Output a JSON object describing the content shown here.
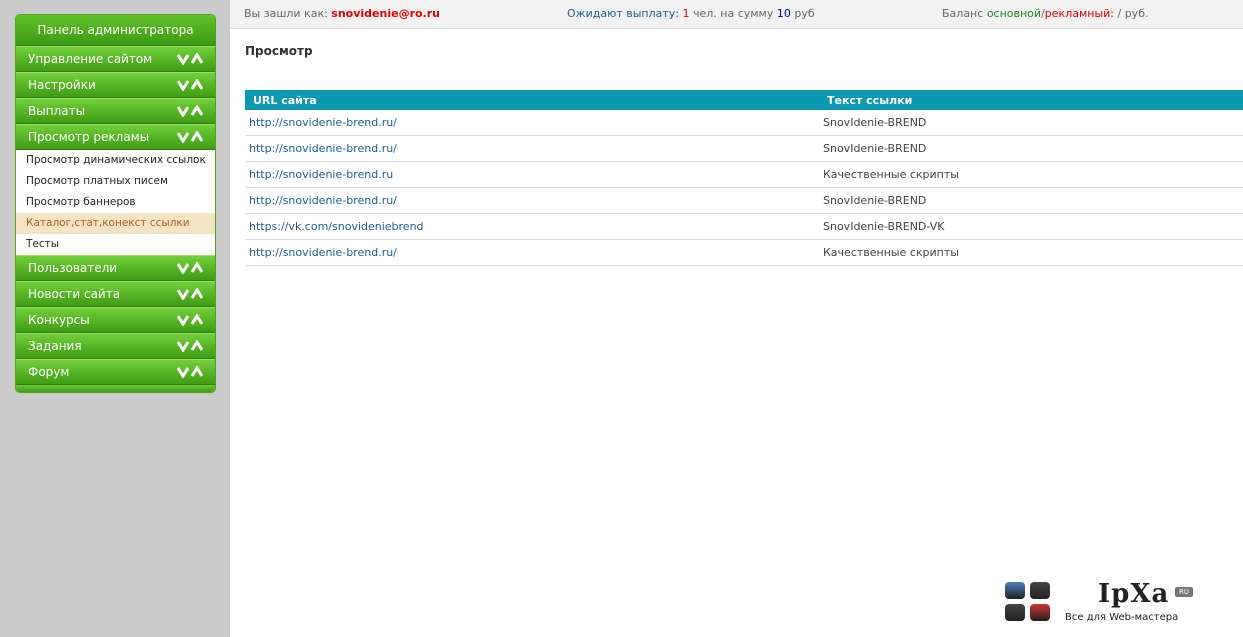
{
  "sidebar": {
    "title": "Панель администратора",
    "groups_top": [
      {
        "label": "Управление сайтом"
      },
      {
        "label": "Настройки"
      },
      {
        "label": "Выплаты"
      },
      {
        "label": "Просмотр рекламы"
      }
    ],
    "sub_items": [
      {
        "label": "Просмотр динамических ссылок"
      },
      {
        "label": "Просмотр платных писем"
      },
      {
        "label": "Просмотр баннеров"
      },
      {
        "label": "Каталог,стат,конекст ссылки"
      },
      {
        "label": "Тесты"
      }
    ],
    "groups_bottom": [
      {
        "label": "Пользователи"
      },
      {
        "label": "Новости сайта"
      },
      {
        "label": "Конкурсы"
      },
      {
        "label": "Задания"
      },
      {
        "label": "Форум"
      }
    ]
  },
  "topbar": {
    "logged_prefix": "Вы зашли как:",
    "user": "snovidenie@ro.ru",
    "payout_prefix": "Ожидают выплату:",
    "payout_count": "1",
    "payout_mid": "чел. на сумму",
    "payout_sum": "10",
    "payout_unit": "руб",
    "balance_prefix": "Баланс",
    "balance_main": "основной",
    "balance_sep": "/",
    "balance_ad": "рекламный:",
    "balance_value": "/ руб."
  },
  "main": {
    "title": "Просмотр",
    "columns": [
      "URL сайта",
      "Текст ссылки"
    ],
    "rows": [
      {
        "url": "http://snovidenie-brend.ru/",
        "text": "SnovIdenie-BREND"
      },
      {
        "url": "http://snovidenie-brend.ru/",
        "text": "SnovIdenie-BREND"
      },
      {
        "url": "http://snovidenie-brend.ru",
        "text": "Качественные скрипты"
      },
      {
        "url": "http://snovidenie-brend.ru/",
        "text": "SnovIdenie-BREND"
      },
      {
        "url": "https://vk.com/snovideniebrend",
        "text": "SnovIdenie-BREND-VK"
      },
      {
        "url": "http://snovidenie-brend.ru/",
        "text": "Качественные скрипты"
      }
    ]
  },
  "logo": {
    "name": "IpXa",
    "badge": "RU",
    "tagline": "Все для Web-мастера",
    "colors": [
      "#4a7fc1",
      "#444444",
      "#444444",
      "#d03030"
    ]
  },
  "colors": {
    "menu_green": "#4fa31a",
    "table_header": "#0c98b0",
    "active_item_bg": "#f3e4c4",
    "link_blue": "#1d5c9a",
    "accent_red": "#e00000"
  }
}
